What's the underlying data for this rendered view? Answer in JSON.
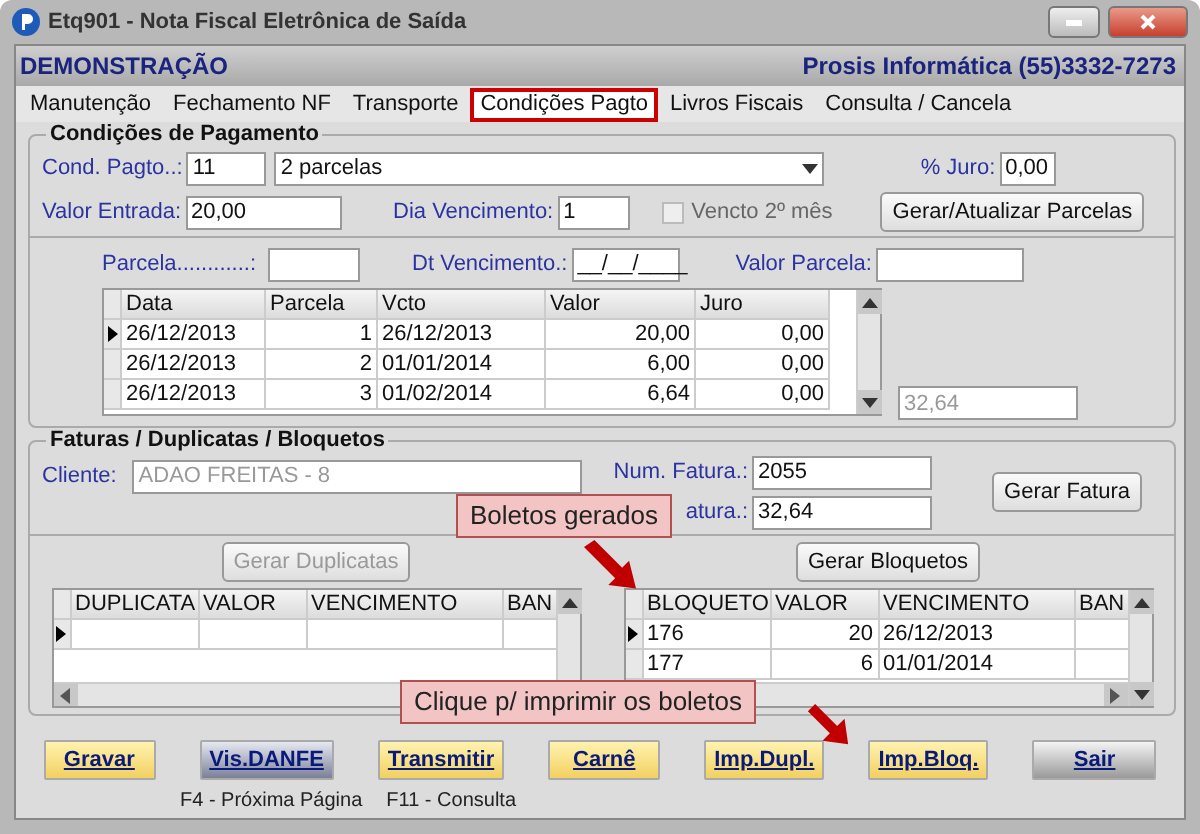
{
  "window": {
    "title": "Etq901 - Nota Fiscal Eletrônica de Saída"
  },
  "header": {
    "company": "DEMONSTRAÇÃO",
    "contact": "Prosis Informática (55)3332-7273"
  },
  "tabs": [
    {
      "label": "Manutenção",
      "selected": false
    },
    {
      "label": "Fechamento NF",
      "selected": false
    },
    {
      "label": "Transporte",
      "selected": false
    },
    {
      "label": "Condições Pagto",
      "selected": true
    },
    {
      "label": "Livros Fiscais",
      "selected": false
    },
    {
      "label": "Consulta / Cancela",
      "selected": false
    }
  ],
  "payment": {
    "title": "Condições de Pagamento",
    "cond_label": "Cond. Pagto..:",
    "cond_code": "11",
    "cond_desc": "2 parcelas",
    "juro_label": "% Juro:",
    "juro": "0,00",
    "entrada_label": "Valor Entrada:",
    "entrada": "20,00",
    "dia_label": "Dia Vencimento:",
    "dia": "1",
    "vencto2": {
      "label": "Vencto 2º mês",
      "checked": false,
      "disabled": true
    },
    "generate_button": "Gerar/Atualizar Parcelas",
    "parcela_label": "Parcela............:",
    "dt_label": "Dt Vencimento.:",
    "dt_value": "__/__/____",
    "valor_parcela_label": "Valor Parcela:",
    "table": {
      "columns": [
        "Data",
        "Parcela",
        "Vcto",
        "Valor",
        "Juro"
      ],
      "rows": [
        {
          "cells": [
            "26/12/2013",
            "1",
            "26/12/2013",
            "20,00",
            "0,00"
          ],
          "selected": true
        },
        {
          "cells": [
            "26/12/2013",
            "2",
            "01/01/2014",
            "6,00",
            "0,00"
          ],
          "selected": false
        },
        {
          "cells": [
            "26/12/2013",
            "3",
            "01/02/2014",
            "6,64",
            "0,00"
          ],
          "selected": false
        }
      ]
    },
    "total": "32,64"
  },
  "invoices": {
    "title": "Faturas / Duplicatas / Bloquetos",
    "cliente_label": "Cliente:",
    "cliente": "ADAO FREITAS - 8",
    "num_label": "Num. Fatura.:",
    "num": "2055",
    "valor_label": "atura.:",
    "valor": "32,64",
    "fatura_button": "Gerar Fatura",
    "duplicatas": {
      "button": {
        "label": "Gerar Duplicatas",
        "disabled": true
      },
      "columns": [
        "DUPLICATA",
        "VALOR",
        "VENCIMENTO",
        "BAN"
      ],
      "rows": [
        {
          "selected": true
        }
      ]
    },
    "bloquetos": {
      "button": {
        "label": "Gerar Bloquetos",
        "disabled": false
      },
      "columns": [
        "BLOQUETO",
        "VALOR",
        "VENCIMENTO",
        "BAN"
      ],
      "rows": [
        {
          "cells": [
            "176",
            "20",
            "26/12/2013"
          ],
          "selected": true
        },
        {
          "cells": [
            "177",
            "6",
            "01/01/2014"
          ],
          "selected": false
        }
      ]
    }
  },
  "callouts": [
    {
      "text": "Boletos gerados"
    },
    {
      "text": "Clique p/ imprimir os boletos"
    }
  ],
  "buttons": [
    {
      "label": "Gravar",
      "kind": "yellow"
    },
    {
      "label": "Vis.DANFE",
      "kind": "blue"
    },
    {
      "label": "Transmitir",
      "kind": "yellow"
    },
    {
      "label": "Carnê",
      "kind": "yellow"
    },
    {
      "label": "Imp.Dupl.",
      "kind": "yellow"
    },
    {
      "label": "Imp.Bloq.",
      "kind": "yellow"
    },
    {
      "label": "Sair",
      "kind": "grey"
    }
  ],
  "status_bar": [
    "F4 - Próxima Página",
    "F11 - Consulta"
  ]
}
